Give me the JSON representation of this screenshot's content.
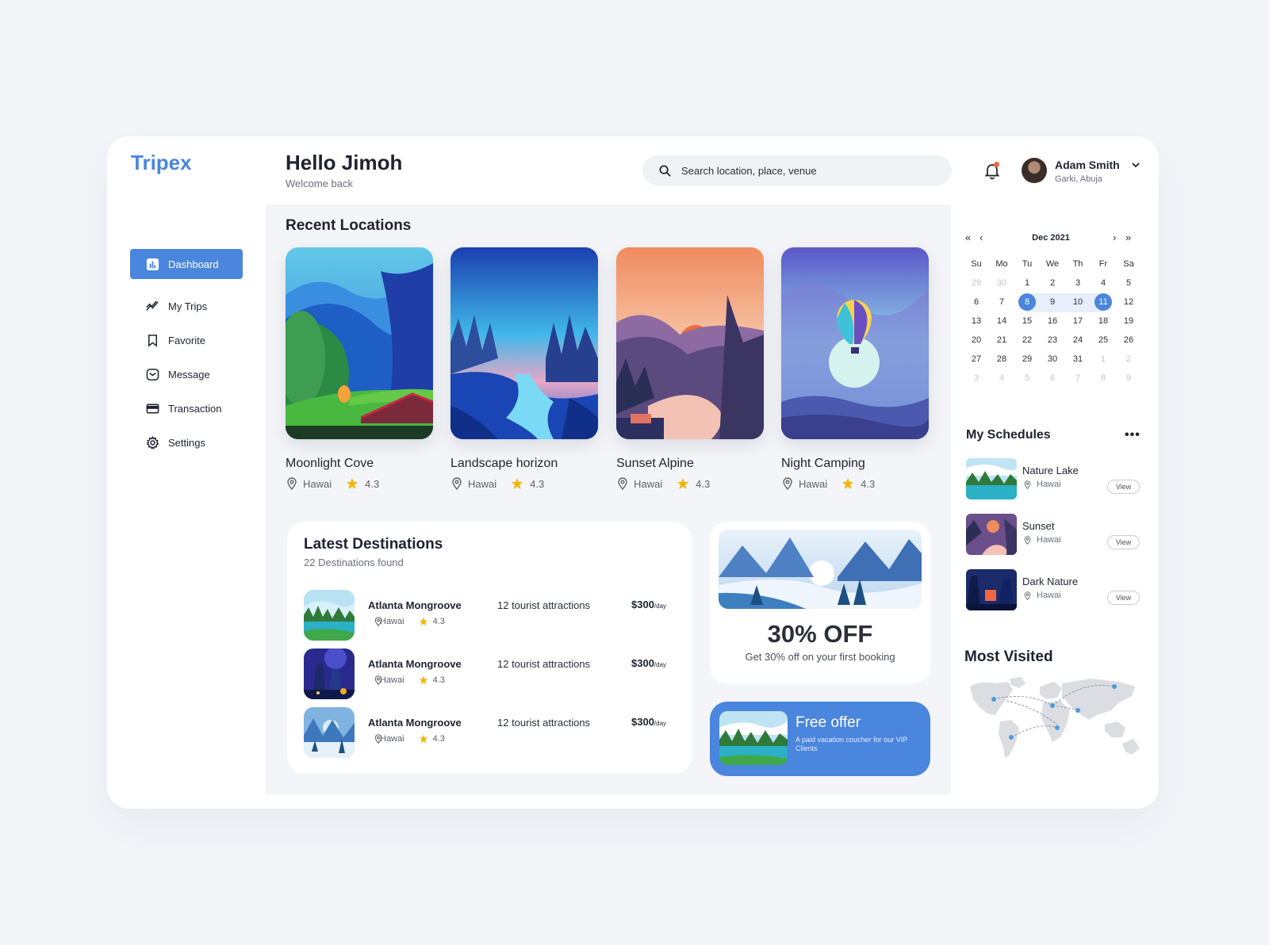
{
  "app": {
    "logo": "Tripex"
  },
  "sidebar": {
    "items": [
      {
        "label": "Dashboard",
        "icon": "chart-icon",
        "active": true
      },
      {
        "label": "My Trips",
        "icon": "trend-icon"
      },
      {
        "label": "Favorite",
        "icon": "bookmark-icon"
      },
      {
        "label": "Message",
        "icon": "message-icon"
      },
      {
        "label": "Transaction",
        "icon": "card-icon"
      },
      {
        "label": "Settings",
        "icon": "gear-icon"
      }
    ]
  },
  "header": {
    "greeting": "Hello Jimoh",
    "subtitle": "Welcome back",
    "search_placeholder": "Search location, place, venue",
    "user_name": "Adam Smith",
    "user_location": "Garki, Abuja"
  },
  "recent": {
    "title": "Recent Locations",
    "cards": [
      {
        "name": "Moonlight Cove",
        "location": "Hawai",
        "rating": "4.3"
      },
      {
        "name": "Landscape horizon",
        "location": "Hawai",
        "rating": "4.3"
      },
      {
        "name": "Sunset Alpine",
        "location": "Hawai",
        "rating": "4.3"
      },
      {
        "name": "Night Camping",
        "location": "Hawai",
        "rating": "4.3"
      }
    ]
  },
  "latest": {
    "title": "Latest Destinations",
    "found": "22 Destinations found",
    "rows": [
      {
        "name": "Atlanta Mongroove",
        "location": "Hawai",
        "rating": "4.3",
        "attractions": "12 tourist attractions",
        "price": "$300",
        "unit": "/day"
      },
      {
        "name": "Atlanta Mongroove",
        "location": "Hawai",
        "rating": "4.3",
        "attractions": "12 tourist attractions",
        "price": "$300",
        "unit": "/day"
      },
      {
        "name": "Atlanta Mongroove",
        "location": "Hawai",
        "rating": "4.3",
        "attractions": "12 tourist attractions",
        "price": "$300",
        "unit": "/day"
      }
    ]
  },
  "offer": {
    "headline": "30% OFF",
    "text": "Get 30% off on your first booking"
  },
  "free_offer": {
    "title": "Free offer",
    "text": "A paid vacation coucher for our VIP Clients"
  },
  "calendar": {
    "month": "Dec 2021",
    "nav": {
      "prev_year": "«",
      "prev": "‹",
      "next": "›",
      "next_year": "»"
    },
    "weekdays": [
      "Su",
      "Mo",
      "Tu",
      "We",
      "Th",
      "Fr",
      "Sa"
    ],
    "days": [
      "29",
      "30",
      "1",
      "2",
      "3",
      "4",
      "5",
      "6",
      "7",
      "8",
      "9",
      "10",
      "11",
      "12",
      "13",
      "14",
      "15",
      "16",
      "17",
      "18",
      "19",
      "20",
      "21",
      "22",
      "23",
      "24",
      "25",
      "26",
      "27",
      "28",
      "29",
      "30",
      "31",
      "1",
      "2",
      "3",
      "4",
      "5",
      "6",
      "7",
      "8",
      "9"
    ],
    "range_start": "8",
    "range_end": "11"
  },
  "schedules": {
    "title": "My Schedules",
    "more": "•••",
    "items": [
      {
        "name": "Nature Lake",
        "location": "Hawai",
        "action": "View"
      },
      {
        "name": "Sunset",
        "location": "Hawai",
        "action": "View"
      },
      {
        "name": "Dark Nature",
        "location": "Hawai",
        "action": "View"
      }
    ]
  },
  "most_visited": {
    "title": "Most Visited"
  },
  "colors": {
    "accent": "#4a85de",
    "star": "#f5b400",
    "notification": "#f26542"
  }
}
